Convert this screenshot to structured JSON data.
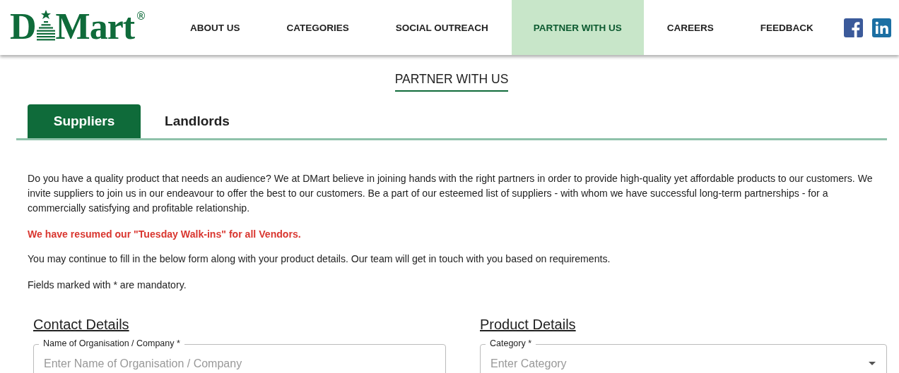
{
  "logo": {
    "first": "D",
    "rest": "Mart",
    "mark": "®"
  },
  "nav": [
    {
      "label": "ABOUT US",
      "selected": false
    },
    {
      "label": "CATEGORIES",
      "selected": false
    },
    {
      "label": "SOCIAL OUTREACH",
      "selected": false
    },
    {
      "label": "PARTNER WITH US",
      "selected": true
    },
    {
      "label": "CAREERS",
      "selected": false
    },
    {
      "label": "FEEDBACK",
      "selected": false
    }
  ],
  "social": [
    {
      "kind": "facebook"
    },
    {
      "kind": "linkedin"
    }
  ],
  "page_title": "PARTNER WITH US",
  "tabs": [
    {
      "label": "Suppliers",
      "selected": true
    },
    {
      "label": "Landlords",
      "selected": false
    }
  ],
  "paragraphs": [
    {
      "kind": "normal",
      "text": "Do you have a quality product that needs an audience? We at DMart believe in joining hands with the right partners in order to provide high-quality yet affordable products to our customers. We invite suppliers to join us in our endeavour to offer the best to our customers. Be a part of our esteemed list of suppliers - with whom we have successful long-term partnerships - for a commercially satisfying and profitable relationship."
    },
    {
      "kind": "alert",
      "text": "We have resumed our \"Tuesday Walk-ins\" for all Vendors."
    },
    {
      "kind": "normal",
      "text": "You may continue to fill in the below form along with your product details. Our team will get in touch with you based on requirements."
    },
    {
      "kind": "normal",
      "text": "Fields marked with * are mandatory."
    }
  ],
  "sections": [
    {
      "heading": "Contact Details",
      "fields": [
        {
          "kind": "text",
          "label": "Name of Organisation / Company *",
          "placeholder": "Enter Name of Organisation / Company"
        }
      ]
    },
    {
      "heading": "Product Details",
      "fields": [
        {
          "kind": "select",
          "label": "Category *",
          "placeholder": "Enter Category"
        }
      ]
    }
  ]
}
